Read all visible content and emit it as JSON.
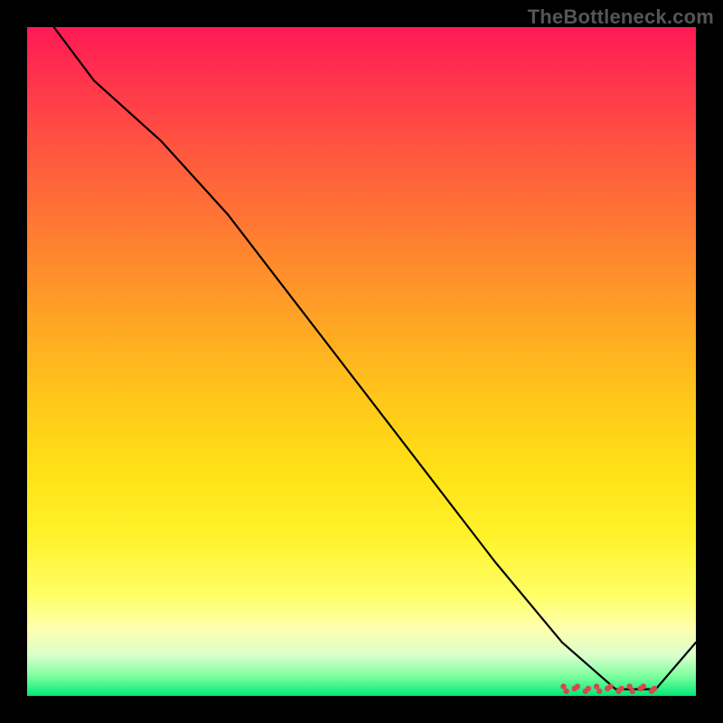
{
  "watermark": "TheBottleneck.com",
  "chart_data": {
    "type": "line",
    "title": "",
    "xlabel": "",
    "ylabel": "",
    "xlim": [
      0,
      100
    ],
    "ylim": [
      0,
      100
    ],
    "grid": false,
    "series": [
      {
        "name": "curve",
        "x": [
          4,
          10,
          20,
          30,
          40,
          50,
          60,
          70,
          80,
          88,
          94,
          100
        ],
        "values": [
          100,
          92,
          83,
          72,
          59,
          46,
          33,
          20,
          8,
          1,
          1,
          8
        ],
        "color": "#000000"
      }
    ],
    "markers": {
      "name": "dense-markers",
      "y": 1,
      "x_start": 80,
      "x_end": 94,
      "count": 18,
      "color": "#d44a4a",
      "radius": 3.2
    }
  }
}
